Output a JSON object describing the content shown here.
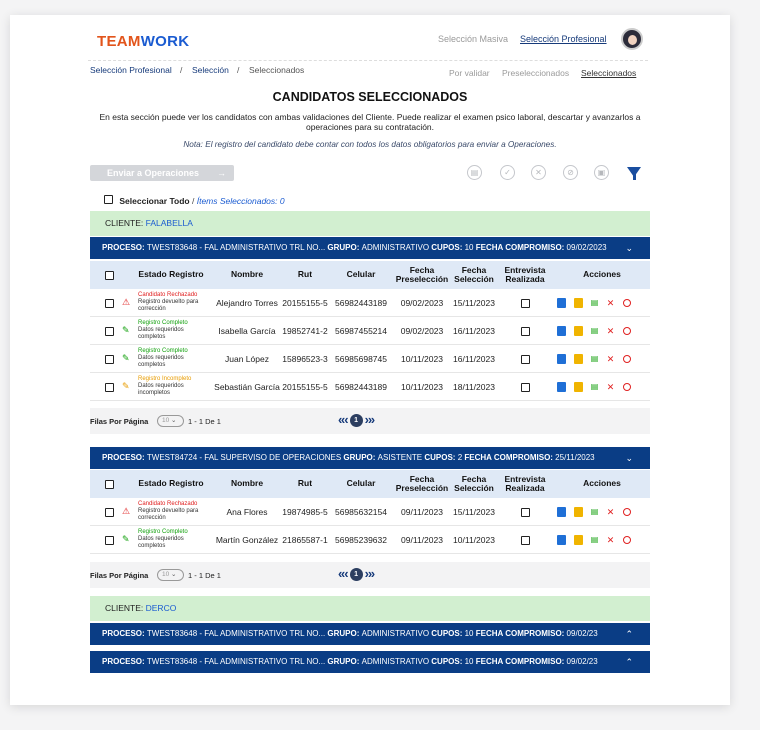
{
  "brand": {
    "part1": "TEAM",
    "part2": "WORK"
  },
  "topnav": [
    "Selección Masiva",
    "Selección Profesional"
  ],
  "breadcrumb": [
    "Selección Profesional",
    "Selección",
    "Seleccionados"
  ],
  "breadcrumb_sep": "/",
  "subnav": [
    "Por validar",
    "Preseleccionados",
    "Seleccionados"
  ],
  "page": {
    "title": "CANDIDATOS SELECCIONADOS",
    "description": "En esta sección puede ver los candidatos con ambas validaciones del Cliente. Puede realizar el examen psico laboral, descartar y avanzarlos a operaciones para su contratación.",
    "note": "Nota: El registro del candidato debe contar con todos los datos obligatorios para enviar a Operaciones."
  },
  "toolbar": {
    "send_label": "Enviar a Operaciones",
    "send_arrow": "→"
  },
  "select": {
    "all_label": "Seleccionar Todo",
    "sep": "/",
    "items_label": "Ítems Seleccionados: 0"
  },
  "labels": {
    "client": "CLIENTE:",
    "process": "PROCESO:",
    "group": "GRUPO:",
    "quotas": "CUPOS:",
    "deadline": "FECHA COMPROMISO:",
    "rows_per_page": "Filas Por Página",
    "page_size": "10",
    "page": "1"
  },
  "columns": [
    "Estado Registro",
    "Nombre",
    "Rut",
    "Celular",
    "Fecha Preselección",
    "Fecha Selección",
    "Entrevista Realizada",
    "Acciones"
  ],
  "clients": [
    {
      "name": "FALABELLA"
    },
    {
      "name": "DERCO"
    }
  ],
  "processes": [
    {
      "code": "TWEST83648 - FAL ADMINISTRATIVO TRL NO...",
      "group": "ADMINISTRATIVO",
      "quotas": "10",
      "deadline": "09/02/2023",
      "chevron": "⌄",
      "range": "1 - 1 De 1",
      "rows": [
        {
          "status": "Candidato Rechazado",
          "detail": "Registro devuelto para corrección",
          "name": "Alejandro Torres",
          "rut": "20155155-5",
          "phone": "56982443189",
          "pre": "09/02/2023",
          "sel": "15/11/2023"
        },
        {
          "status": "Registro Completo",
          "detail": "Datos requeridos completos",
          "name": "Isabella García",
          "rut": "19852741-2",
          "phone": "56987455214",
          "pre": "09/02/2023",
          "sel": "16/11/2023"
        },
        {
          "status": "Registro Completo",
          "detail": "Datos requeridos completos",
          "name": "Juan López",
          "rut": "15896523-3",
          "phone": "56985698745",
          "pre": "10/11/2023",
          "sel": "16/11/2023"
        },
        {
          "status": "Registro  Incompleto",
          "detail": "Datos requeridos incompletos",
          "name": "Sebastián García",
          "rut": "20155155-5",
          "phone": "56982443189",
          "pre": "10/11/2023",
          "sel": "18/11/2023"
        }
      ]
    },
    {
      "code": "TWEST84724 - FAL SUPERVISO DE OPERACIONES",
      "group": "ASISTENTE",
      "quotas": "2",
      "deadline": "25/11/2023",
      "chevron": "⌄",
      "range": "1 - 1 De 1",
      "rows": [
        {
          "status": "Candidato Rechazado",
          "detail": "Registro devuelto para corrección",
          "name": "Ana Flores",
          "rut": "19874985-5",
          "phone": "56985632154",
          "pre": "09/11/2023",
          "sel": "15/11/2023"
        },
        {
          "status": "Registro Completo",
          "detail": "Datos requeridos completos",
          "name": "Martín González",
          "rut": "21865587-1",
          "phone": "56985239632",
          "pre": "09/11/2023",
          "sel": "10/11/2023"
        }
      ]
    },
    {
      "code": "TWEST83648 - FAL ADMINISTRATIVO TRL NO...",
      "group": "ADMINISTRATIVO",
      "quotas": "10",
      "deadline": "09/02/23",
      "chevron": "⌃"
    },
    {
      "code": "TWEST83648 - FAL ADMINISTRATIVO TRL NO...",
      "group": "ADMINISTRATIVO",
      "quotas": "10",
      "deadline": "09/02/23",
      "chevron": "⌃"
    }
  ],
  "colors": {
    "primary": "#0a3d85",
    "client_bg": "#d2efd0",
    "header_bg": "#dfe9f6",
    "rejected": "#e02020",
    "complete": "#13a10e",
    "incomplete": "#e89c00"
  }
}
